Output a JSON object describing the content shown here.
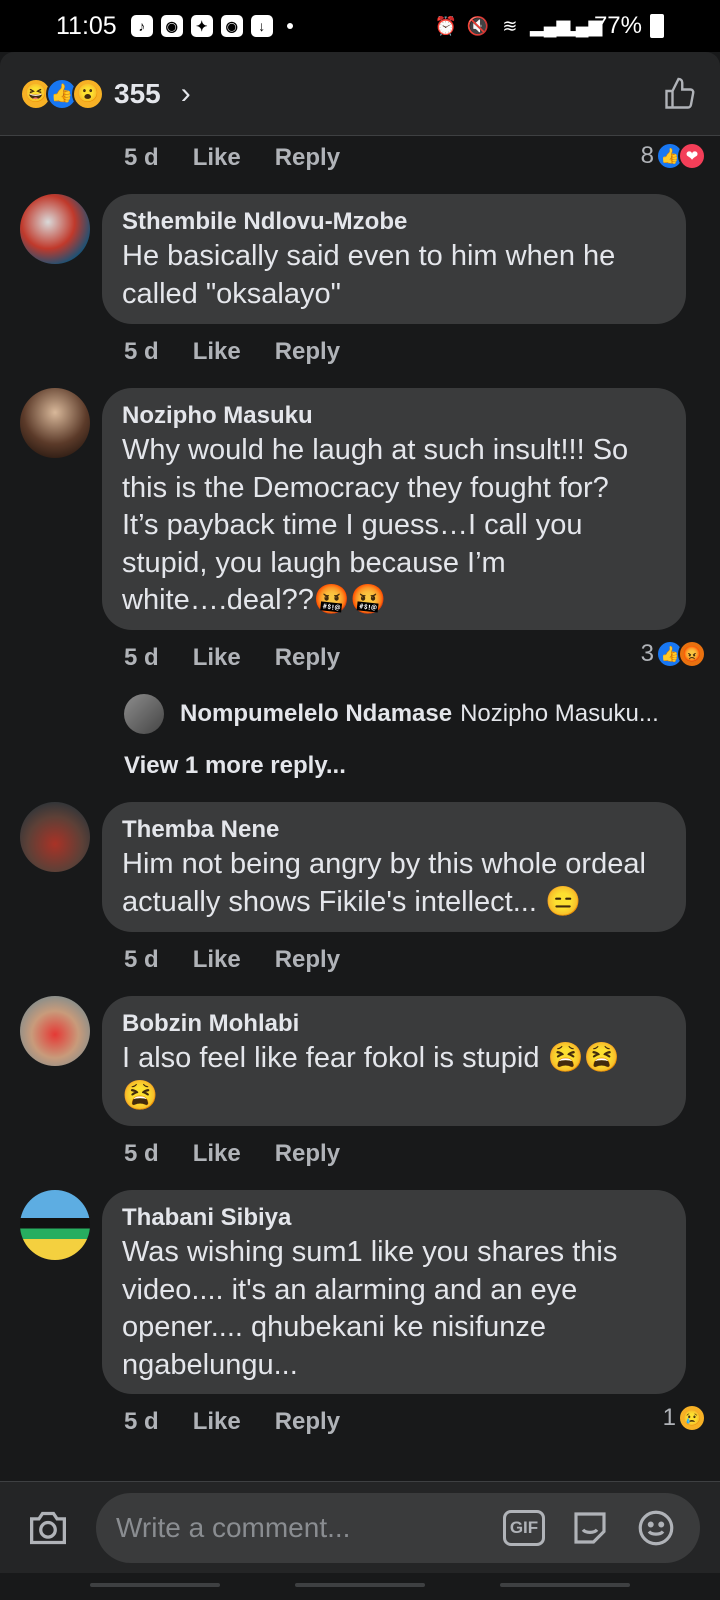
{
  "status_bar": {
    "time": "11:05",
    "battery": "77%"
  },
  "header": {
    "reaction_count": "355",
    "reactions": [
      "haha",
      "like",
      "wow"
    ]
  },
  "top_action_row": {
    "time": "5 d",
    "like": "Like",
    "reply": "Reply",
    "reaction_count": "8",
    "reactions": [
      "like",
      "love"
    ]
  },
  "comments": [
    {
      "author": "Sthembile Ndlovu-Mzobe",
      "lines": [
        "He basically said even to him when he",
        "called \"oksalayo\""
      ],
      "time": "5 d",
      "like": "Like",
      "reply": "Reply"
    },
    {
      "author": "Nozipho Masuku",
      "lines": [
        "Why would he laugh at such insult!!! So",
        "this is the Democracy they fought for?",
        "It’s payback time I guess…I call you",
        "stupid, you laugh because I’m",
        "white….deal??🤬🤬"
      ],
      "time": "5 d",
      "like": "Like",
      "reply": "Reply",
      "reaction_count": "3",
      "reactions": [
        "like",
        "angry"
      ],
      "reply_preview": {
        "name": "Nompumelelo Ndamase",
        "snippet": "Nozipho Masuku..."
      },
      "view_more": "View 1 more reply..."
    },
    {
      "author": "Themba Nene",
      "lines": [
        "Him not being angry by this whole ordeal",
        "actually shows Fikile's intellect... 😑"
      ],
      "time": "5 d",
      "like": "Like",
      "reply": "Reply"
    },
    {
      "author": "Bobzin Mohlabi",
      "lines": [
        "I also feel like fear fokol is stupid 😫😫",
        "😫"
      ],
      "time": "5 d",
      "like": "Like",
      "reply": "Reply"
    },
    {
      "author": "Thabani Sibiya",
      "lines": [
        "Was wishing sum1 like you shares this",
        "video.... it's an alarming and an eye",
        "opener.... qhubekani ke nisifunze",
        "ngabelungu..."
      ],
      "time": "5 d",
      "like": "Like",
      "reply": "Reply",
      "reaction_count": "1",
      "reactions": [
        "sad"
      ]
    }
  ],
  "composer": {
    "placeholder": "Write a comment...",
    "gif_label": "GIF"
  },
  "icons": {
    "camera": "camera-icon",
    "sticker": "sticker-icon",
    "emoji": "emoji-icon",
    "like": "thumbs-up-icon"
  },
  "colors": {
    "background": "#18191a",
    "bubble": "#3a3b3c",
    "header": "#242526",
    "secondary_text": "#b0b3b8",
    "like_blue": "#1877f2",
    "love_red": "#f33e58",
    "angry_orange": "#e9710f"
  }
}
